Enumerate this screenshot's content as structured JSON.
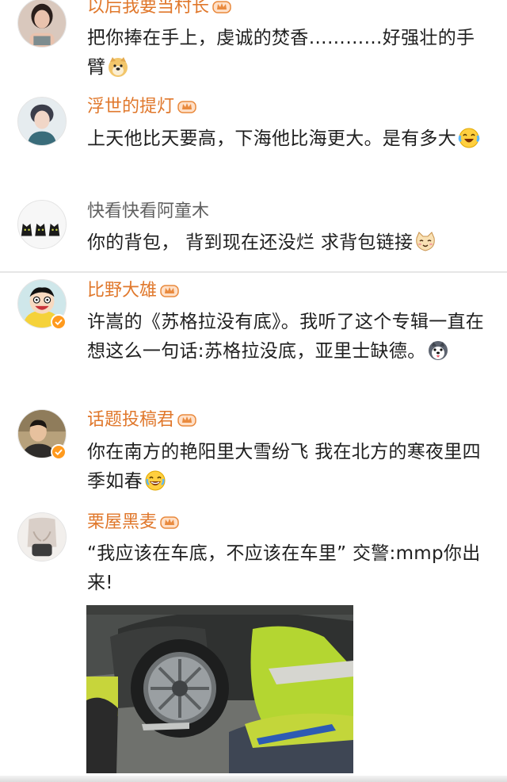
{
  "comments": [
    {
      "username": "以后我要当村长",
      "text": "把你捧在手上，虔诚的焚香…………好强壮的手臂",
      "emoji": "doge-emoji"
    },
    {
      "username": "浮世的提灯",
      "text": "上天他比天要高，下海他比海更大。是有多大",
      "emoji": "laugh-cry-emoji"
    },
    {
      "username": "快看快看阿童木",
      "text": "你的背包， 背到现在还没烂 求背包链接",
      "emoji": "cat-emoji"
    },
    {
      "username": "比野大雄",
      "text": "许嵩的《苏格拉没有底》。我听了这个专辑一直在想这么一句话:苏格拉没底，亚里士缺德。",
      "emoji": "husky-emoji"
    },
    {
      "username": "话题投稿君",
      "text": "你在南方的艳阳里大雪纷飞 我在北方的寒夜里四季如春",
      "emoji": "laugh-emoji"
    },
    {
      "username": "栗屋黑麦",
      "text": "“我应该在车底，不应该在车里” 交警:mmp你出来!"
    }
  ],
  "colors": {
    "vip_name": "#e0782c",
    "plain_name": "#5f5f5f",
    "body_text": "#1f1f1f",
    "verified_badge": "#ff9a1e"
  },
  "icons": {
    "member_badge": "crown-icon",
    "verified": "verified-badge-icon"
  }
}
